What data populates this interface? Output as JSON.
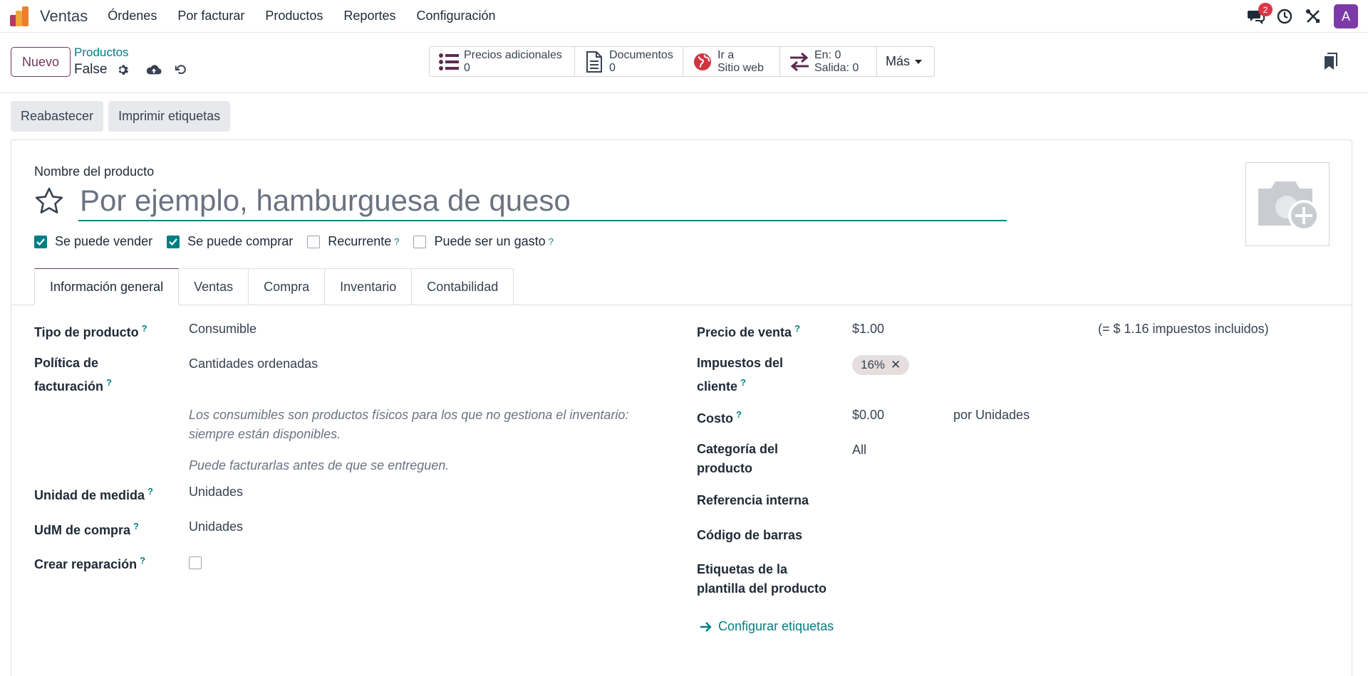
{
  "navbar": {
    "app_name": "Ventas",
    "menu": [
      "Órdenes",
      "Por facturar",
      "Productos",
      "Reportes",
      "Configuración"
    ],
    "message_count": "2",
    "avatar_letter": "A"
  },
  "control_panel": {
    "new_button": "Nuevo",
    "breadcrumb": "Productos",
    "record_name": "False",
    "smart_buttons": {
      "extra_prices_label": "Precios adicionales",
      "extra_prices_count": "0",
      "documents_label": "Documentos",
      "documents_count": "0",
      "website_line1": "Ir a",
      "website_line2": "Sitio web",
      "in_label": "En: 0",
      "out_label": "Salida: 0",
      "more_label": "Más"
    }
  },
  "actions": {
    "replenish": "Reabastecer",
    "print_labels": "Imprimir etiquetas"
  },
  "form": {
    "product_name_label": "Nombre del producto",
    "product_name_placeholder": "Por ejemplo, hamburguesa de queso",
    "checkboxes": {
      "can_sell": "Se puede vender",
      "can_purchase": "Se puede comprar",
      "recurring": "Recurrente",
      "expense": "Puede ser un gasto"
    },
    "tabs": [
      "Información general",
      "Ventas",
      "Compra",
      "Inventario",
      "Contabilidad"
    ],
    "left": {
      "product_type_label": "Tipo de producto",
      "product_type_value": "Consumible",
      "invoice_policy_label_1": "Política de",
      "invoice_policy_label_2": "facturación",
      "invoice_policy_value": "Cantidades ordenadas",
      "note_1a": "Los consumibles son productos físicos para los que no gestiona el inventario:",
      "note_1b": "siempre están disponibles.",
      "note_2": "Puede facturarlas antes de que se entreguen.",
      "uom_label": "Unidad de medida",
      "uom_value": "Unidades",
      "purchase_uom_label": "UdM de compra",
      "purchase_uom_value": "Unidades",
      "create_repair_label": "Crear reparación"
    },
    "right": {
      "sale_price_label": "Precio de venta",
      "sale_price_value": "$1.00",
      "tax_included": "(= $ 1.16 impuestos incluidos)",
      "customer_taxes_label_1": "Impuestos del",
      "customer_taxes_label_2": "cliente",
      "tax_tag": "16%",
      "cost_label": "Costo",
      "cost_value": "$0.00",
      "cost_unit": "por Unidades",
      "category_label_1": "Categoría del",
      "category_label_2": "producto",
      "category_value": "All",
      "internal_ref_label": "Referencia interna",
      "barcode_label": "Código de barras",
      "template_tags_label_1": "Etiquetas de la",
      "template_tags_label_2": "plantilla del producto",
      "configure_tags_link": "Configurar etiquetas"
    }
  },
  "colors": {
    "primary": "#71375f",
    "teal": "#017e84",
    "badge": "#dc3545",
    "avatar": "#7c3aa8"
  }
}
